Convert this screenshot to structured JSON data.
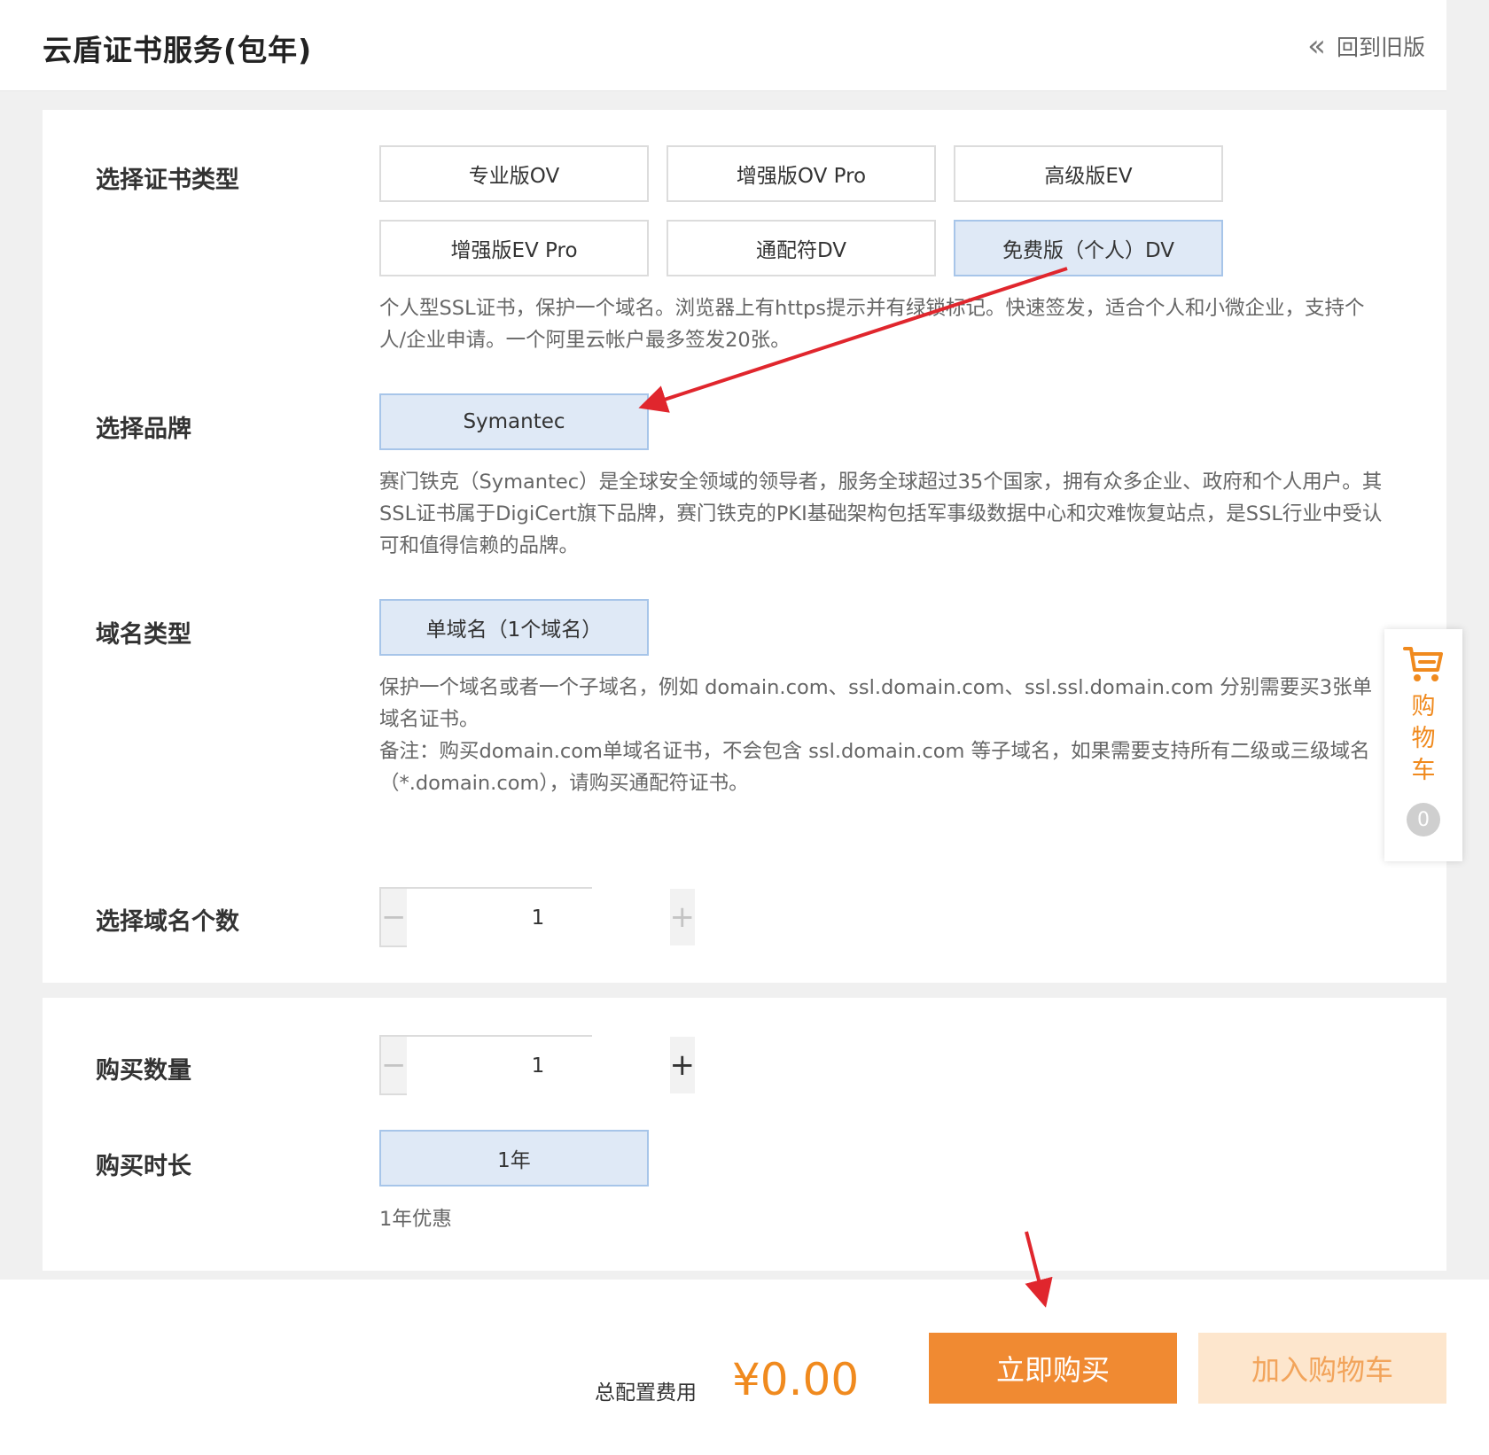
{
  "header": {
    "title": "云盾证书服务(包年)",
    "back_label": "回到旧版"
  },
  "cert_type": {
    "label": "选择证书类型",
    "options": [
      "专业版OV",
      "增强版OV Pro",
      "高级版EV",
      "增强版EV Pro",
      "通配符DV",
      "免费版（个人）DV"
    ],
    "selected": "免费版（个人）DV",
    "description": "个人型SSL证书，保护一个域名。浏览器上有https提示并有绿锁标记。快速签发，适合个人和小微企业，支持个人/企业申请。一个阿里云帐户最多签发20张。"
  },
  "brand": {
    "label": "选择品牌",
    "option": "Symantec",
    "description": "赛门铁克（Symantec）是全球安全领域的领导者，服务全球超过35个国家，拥有众多企业、政府和个人用户。其SSL证书属于DigiCert旗下品牌，赛门铁克的PKI基础架构包括军事级数据中心和灾难恢复站点，是SSL行业中受认可和值得信赖的品牌。"
  },
  "domain_type": {
    "label": "域名类型",
    "option": "单域名（1个域名）",
    "description1": "保护一个域名或者一个子域名，例如 domain.com、ssl.domain.com、ssl.ssl.domain.com 分别需要买3张单域名证书。",
    "description2": "备注：购买domain.com单域名证书，不会包含 ssl.domain.com 等子域名，如果需要支持所有二级或三级域名（*.domain.com），请购买通配符证书。"
  },
  "domain_count": {
    "label": "选择域名个数",
    "value": "1"
  },
  "quantity": {
    "label": "购买数量",
    "value": "1"
  },
  "duration": {
    "label": "购买时长",
    "option": "1年",
    "note": "1年优惠"
  },
  "cart": {
    "label": "购物车",
    "count": "0"
  },
  "footer": {
    "total_label": "总配置费用",
    "total_price": "¥0.00",
    "buy_label": "立即购买",
    "add_cart_label": "加入购物车"
  },
  "colors": {
    "accent": "#f08a32",
    "selected_bg": "#dfe9f6",
    "selected_border": "#a7c5e9",
    "annotation": "#e0262d"
  }
}
